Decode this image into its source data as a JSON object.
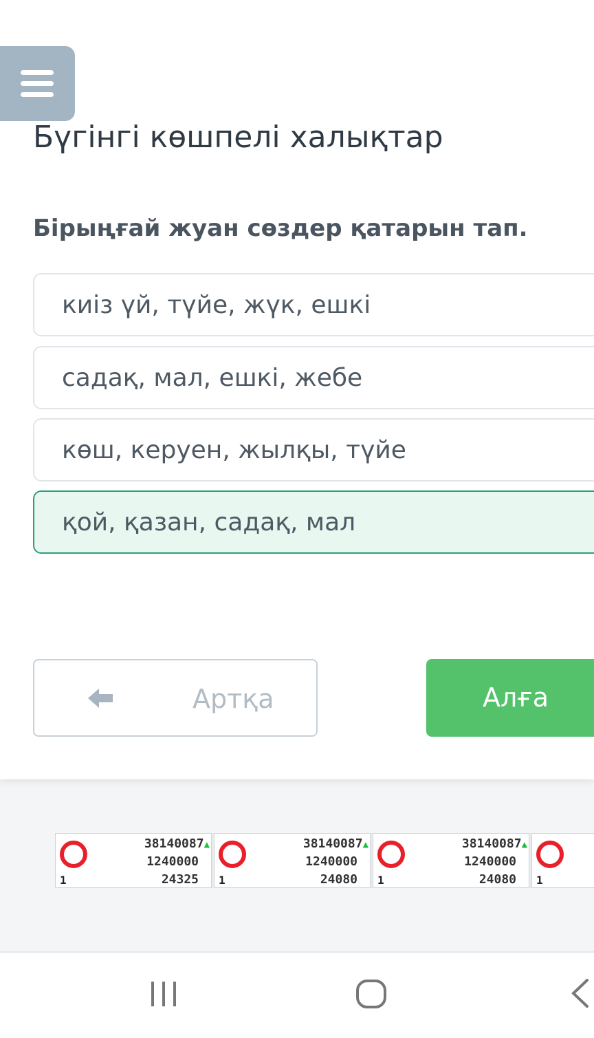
{
  "page": {
    "title": "Бүгінгі көшпелі халықтар",
    "question": "Бірыңғай жуан сөздер қатарын тап."
  },
  "options": [
    {
      "label": "киіз үй, түйе, жүк, ешкі",
      "selected": false
    },
    {
      "label": "садақ, мал, ешкі, жебе",
      "selected": false
    },
    {
      "label": "көш, керуен, жылқы, түйе",
      "selected": false
    },
    {
      "label": "қой, қазан, садақ, мал",
      "selected": true
    }
  ],
  "nav": {
    "back_label": "Артқа",
    "next_label": "Алға"
  },
  "ad_strip": {
    "cells": [
      {
        "index": "1",
        "line1": "38140087",
        "line2": "1240000",
        "line3": "24325"
      },
      {
        "index": "1",
        "line1": "38140087",
        "line2": "1240000",
        "line3": "24080"
      },
      {
        "index": "1",
        "line1": "38140087",
        "line2": "1240000",
        "line3": "24080"
      },
      {
        "index": "1",
        "line1": "",
        "line2": "",
        "line3": ""
      }
    ]
  },
  "icons": {
    "menu": "hamburger-menu-icon",
    "back": "arrow-left-icon",
    "system_recents": "recents-icon",
    "system_home": "home-icon",
    "system_back": "back-chevron-icon"
  },
  "colors": {
    "menu_bg": "#a3b5c2",
    "selected_bg": "#e8f7ef",
    "selected_border": "#2f9e7a",
    "next_button": "#53c26b"
  }
}
